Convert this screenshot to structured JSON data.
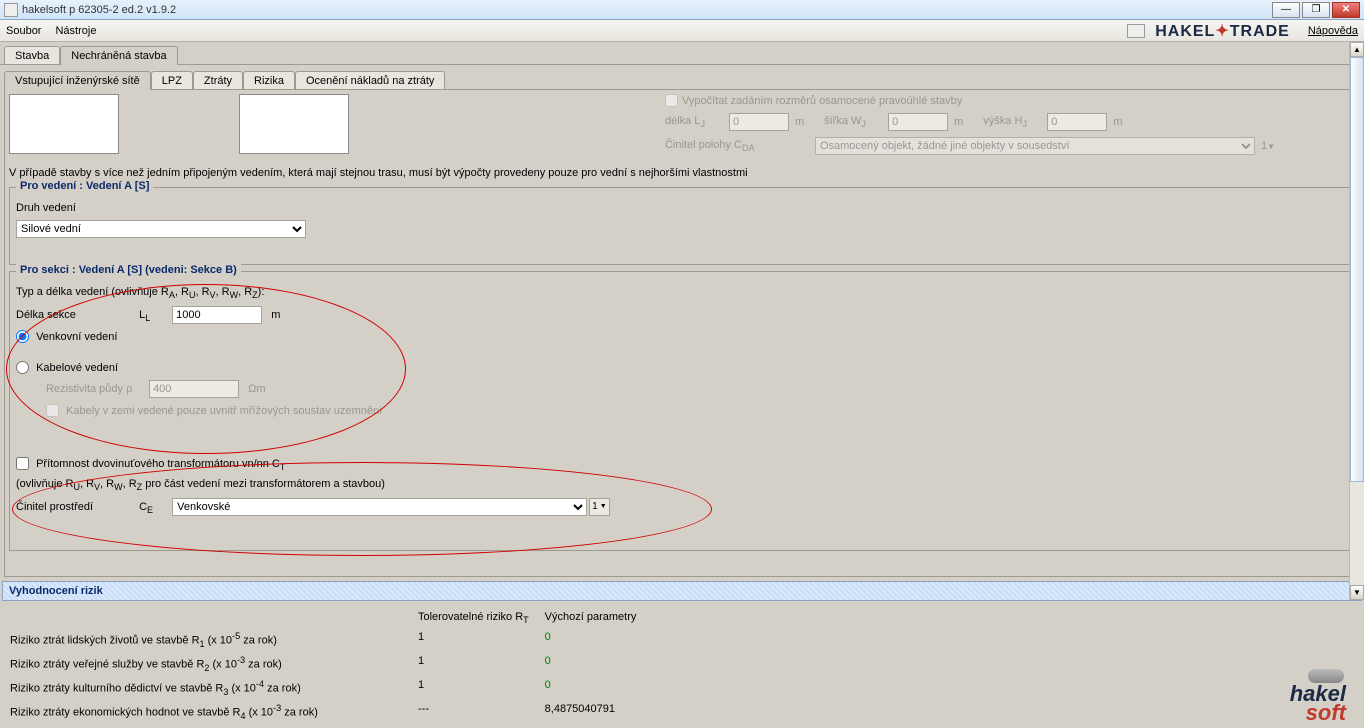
{
  "title": "hakelsoft p 62305-2 ed.2 v1.9.2",
  "menu": {
    "file": "Soubor",
    "tools": "Nástroje",
    "help": "Nápověda",
    "brand1": "HAKEL",
    "brand2": "TRADE"
  },
  "main_tabs": {
    "t1": "Stavba",
    "t2": "Nechráněná stavba"
  },
  "sub_tabs": {
    "s1": "Vstupující inženýrské sítě",
    "s2": "LPZ",
    "s3": "Ztráty",
    "s4": "Rizika",
    "s5": "Ocenění nákladů na ztráty"
  },
  "top": {
    "calc_chk": "Vypočítat zadáním rozměrů osamocené pravoúhlé stavby",
    "delka": "délka L",
    "sirka": "šířka W",
    "vyska": "výška H",
    "val_l": "0",
    "val_w": "0",
    "val_h": "0",
    "m": "m",
    "cinitel": "Činitel polohy C",
    "sub_da": "DA",
    "sub_j": "J",
    "poloha_sel": "Osamocený objekt, žádné jiné objekty v sousedství",
    "one": "1"
  },
  "note": "V případě stavby s více než jedním připojeným vedením, která mají stejnou trasu, musí být výpočty provedeny pouze pro vední s nejhoršími vlastnostmi",
  "fs1": {
    "legend": "Pro vedení : Vedení A [S]",
    "druh": "Druh vedení",
    "sel": "Silové vední"
  },
  "fs2": {
    "legend": "Pro sekci : Vedení A [S] (vedeni: Sekce B)",
    "typ": "Typ a délka vedení (ovlivňuje R",
    "typ2": "):",
    "delka": "Délka sekce",
    "ll": "L",
    "sub_l": "L",
    "val": "1000",
    "m": "m",
    "r1": "Venkovní vedení",
    "r2": "Kabelové vedení",
    "rez": "Rezistivita půdy  ρ",
    "rez_val": "400",
    "ohm": "Ωm",
    "kab": "Kabely v zemi vedené pouze uvnitř mřížových soustav uzemnění",
    "pres": "Přítomnost dvovinuťového transformátoru vn/nn C",
    "sub_t": "T",
    "ovl": "(ovlivňuje R",
    "ovl2": " pro část vedení mezi transformátorem a stavbou)",
    "cin": "Činitel prostředí",
    "ce": "C",
    "sub_e": "E",
    "cin_sel": "Venkovské",
    "one": "1",
    "ra": "A",
    "ru": "U",
    "rv": "V",
    "rw": "W",
    "rz": "Z"
  },
  "risk": {
    "head": "Vyhodnocení rizik",
    "col1": "Tolerovatelné riziko R",
    "sub_t": "T",
    "col2": "Výchozí parametry",
    "r1": "Riziko ztrát lidských životů ve stavbě R",
    "r1b": " (x 10",
    "r1c": " za rok)",
    "e1": "-5",
    "i1": "1",
    "r2": "Riziko ztráty veřejné služby ve stavbě R",
    "e2": "-3",
    "i2": "2",
    "r3": "Riziko ztráty kulturního dědictví ve stavbě R",
    "e3": "-4",
    "i3": "3",
    "r4": "Riziko ztráty ekonomických hodnot ve stavbě R",
    "e4": "-3",
    "i4": "4",
    "v1": "1",
    "v2": "1",
    "v3": "1",
    "v4": "---",
    "w1": "0",
    "w2": "0",
    "w3": "0",
    "w4": "8,4875040791",
    "logo1": "hakel",
    "logo2": "soft"
  }
}
